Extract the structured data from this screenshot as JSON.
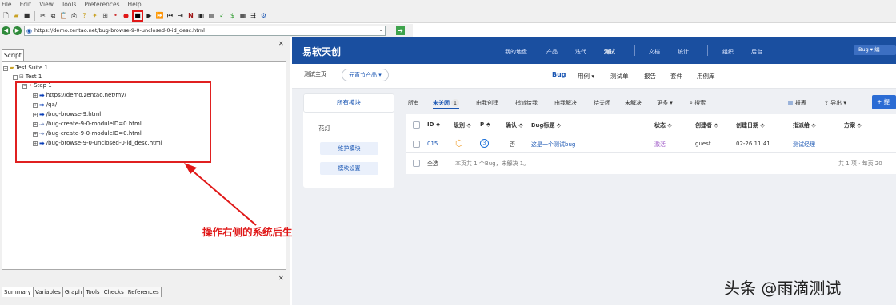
{
  "menu": [
    "File",
    "Edit",
    "View",
    "Tools",
    "Preferences",
    "Help"
  ],
  "address": {
    "url": "https://demo.zentao.net/bug-browse-9-0-unclosed-0-id_desc.html"
  },
  "left": {
    "script_tab": "Script",
    "tree": [
      {
        "label": "Test Suite 1",
        "kind": "suite"
      },
      {
        "label": "Test 1",
        "kind": "test"
      },
      {
        "label": "Step 1",
        "kind": "step"
      },
      {
        "label": "https://demo.zentao.net/my/",
        "kind": "url"
      },
      {
        "label": "/qa/",
        "kind": "url"
      },
      {
        "label": "/bug-browse-9.html",
        "kind": "url"
      },
      {
        "label": "/bug-create-9-0-moduleID=0.html",
        "kind": "url-dim"
      },
      {
        "label": "/bug-create-9-0-moduleID=0.html",
        "kind": "url-dim"
      },
      {
        "label": "/bug-browse-9-0-unclosed-0-id_desc.html",
        "kind": "url"
      }
    ],
    "annotation": "操作右侧的系统后生成的脚本",
    "bottom_tabs": [
      "Summary",
      "Variables",
      "Graph",
      "Tools",
      "Checks",
      "References"
    ]
  },
  "zentao": {
    "brand": "易软天创",
    "nav": [
      "我的地盘",
      "产品",
      "迭代",
      "测试",
      "文档",
      "统计",
      "组织",
      "后台"
    ],
    "nav_active": "测试",
    "bug_pill": "Bug ▾ 编",
    "crumb_home": "测试主页",
    "crumb_product": "元宵节产品 ▾",
    "subnav": [
      "Bug",
      "用例 ▾",
      "测试单",
      "报告",
      "套件",
      "用例库"
    ],
    "all_modules": "所有模块",
    "module_name": "花灯",
    "maintain_btn": "维护模块",
    "settings_btn": "模块设置",
    "filters": {
      "all": "所有",
      "unclosed": "未关闭",
      "unclosed_count": "1",
      "created_by_me": "由我创建",
      "assigned_to_me": "指派给我",
      "resolved_by_me": "由我解决",
      "to_close": "待关闭",
      "unresolved": "未解决",
      "more": "更多 ▾",
      "search": "搜索"
    },
    "actions": {
      "report": "报表",
      "export": "导出 ▾",
      "add": "+ 提"
    },
    "table": {
      "headers": [
        "ID ⬘",
        "级别 ⬘",
        "P ⬘",
        "确认 ⬘",
        "Bug标题 ⬘",
        "状态 ⬘",
        "创建者 ⬘",
        "创建日期 ⬘",
        "指派给 ⬘",
        "方案 ⬘"
      ],
      "rows": [
        [
          "015",
          "3",
          "3",
          "否",
          "这是一个测试bug",
          "激活",
          "guest",
          "02-26 11:41",
          "测试经理",
          ""
        ]
      ],
      "footer_select": "全选",
      "footer_summary": "本页共 1 个Bug，未解决 1。",
      "footer_pager": "共 1 项 · 每页 20"
    }
  },
  "watermark": "头条 @雨滴测试"
}
